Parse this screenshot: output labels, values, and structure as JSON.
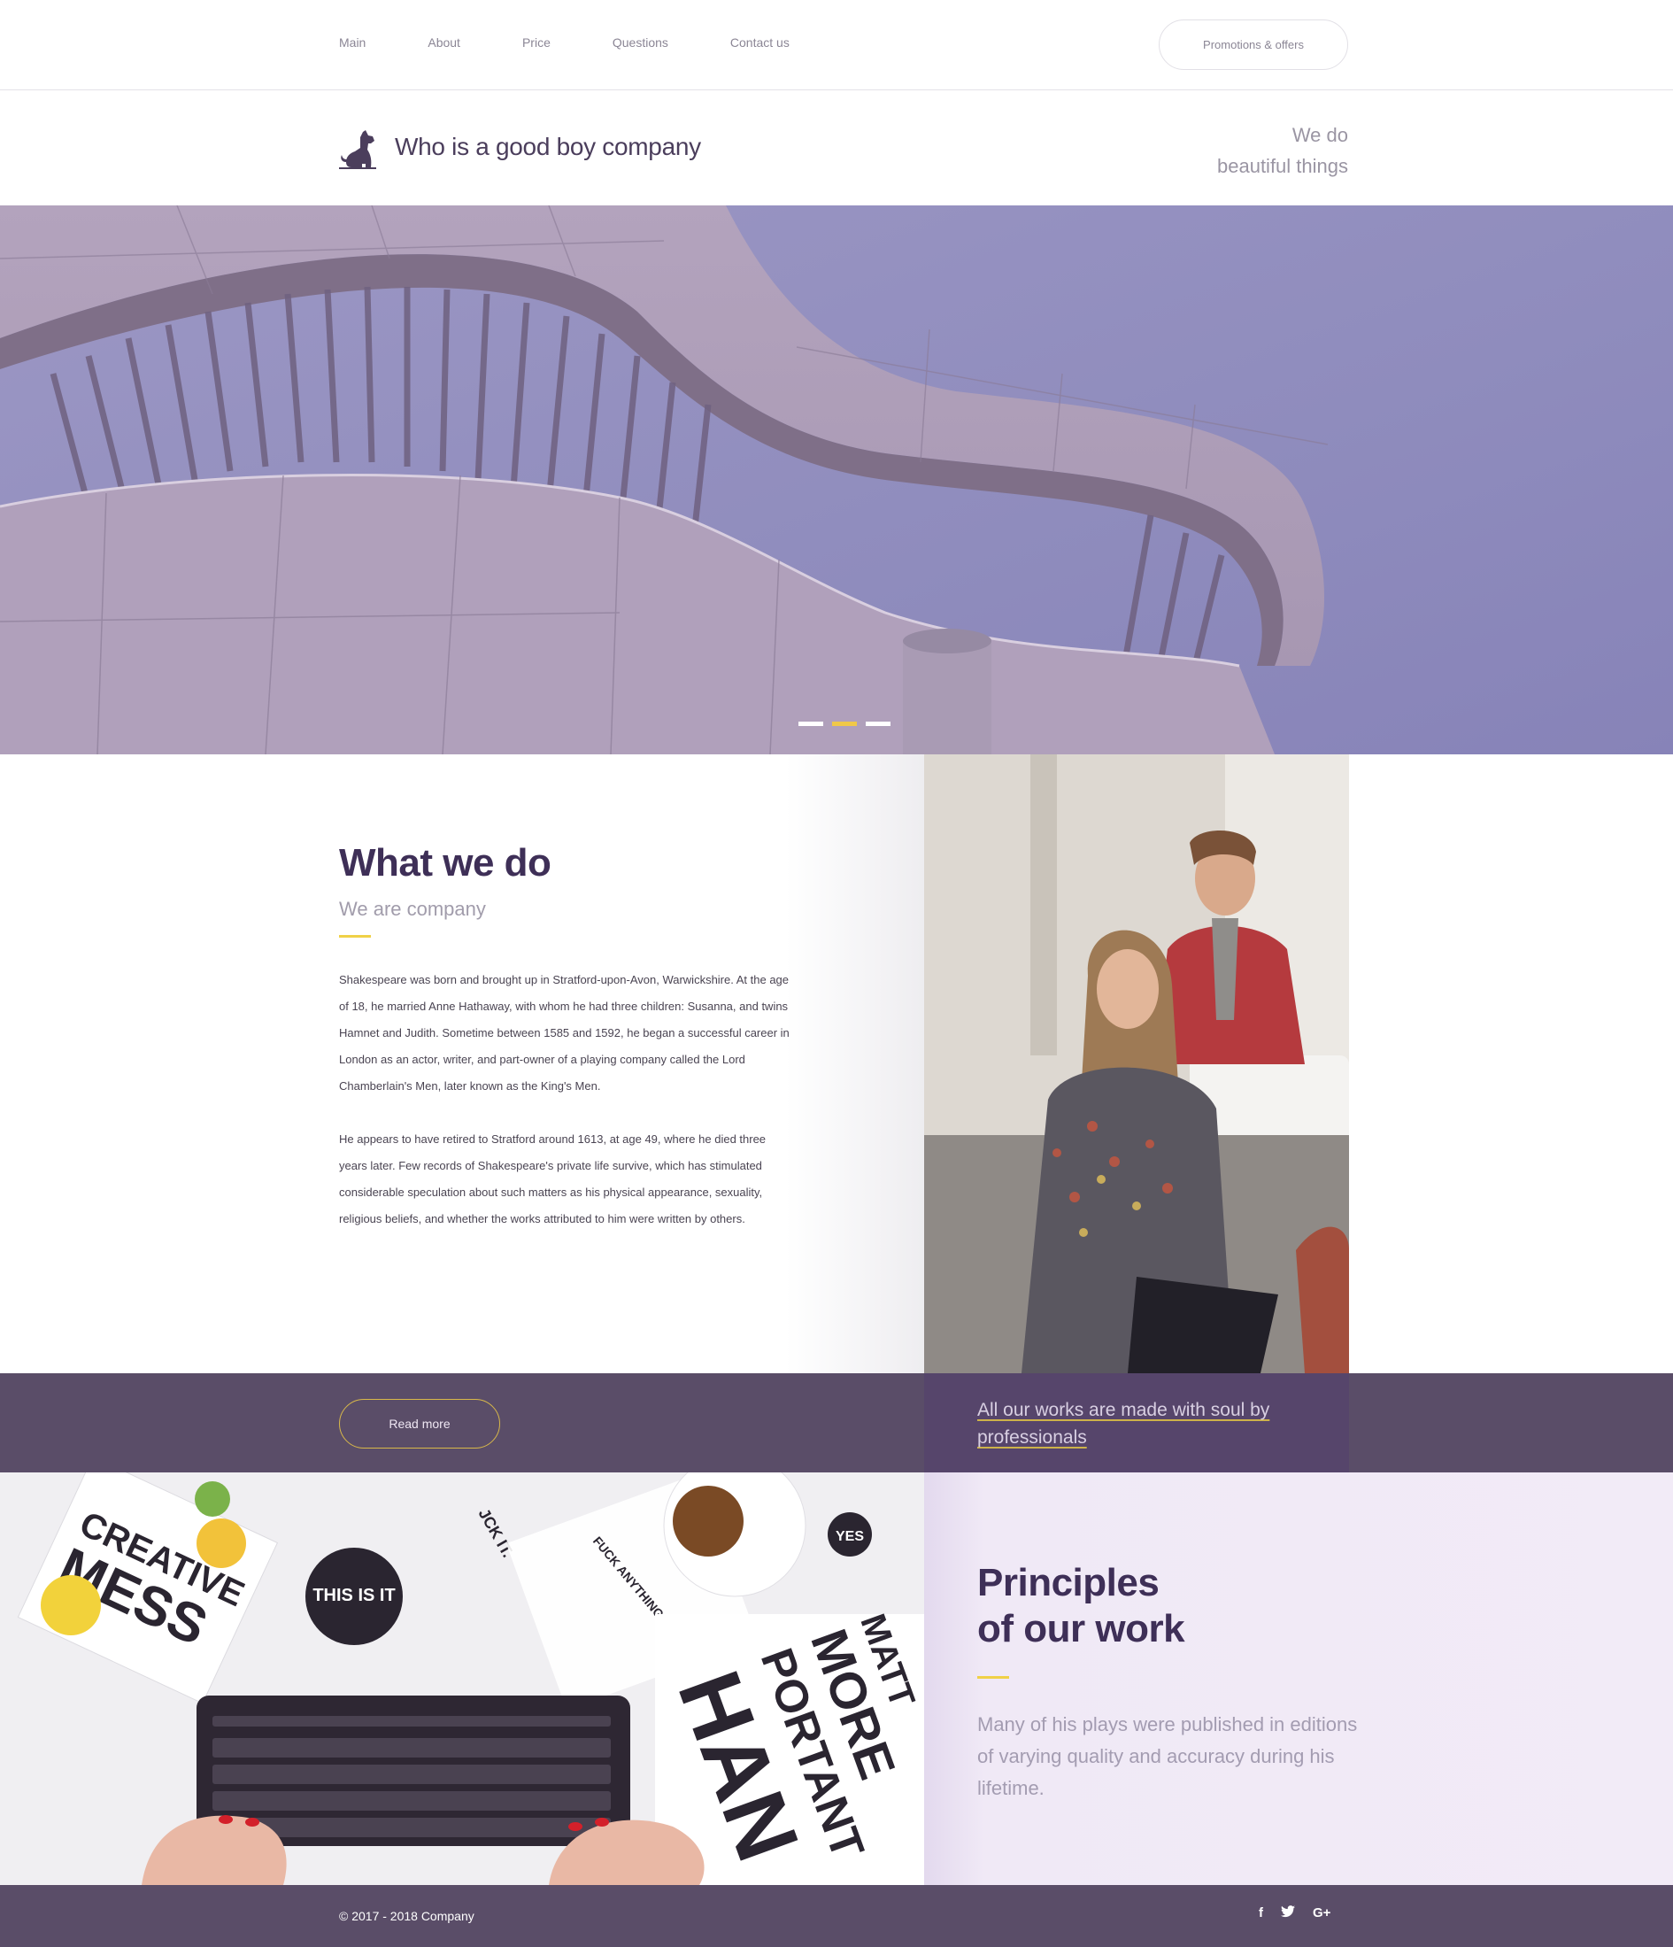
{
  "nav": {
    "items": [
      {
        "label": "Main"
      },
      {
        "label": "About"
      },
      {
        "label": "Price"
      },
      {
        "label": "Questions"
      },
      {
        "label": "Contact us"
      }
    ],
    "promo_label": "Promotions & offers"
  },
  "header": {
    "brand": "Who is a good boy company",
    "tagline_line1": "We do",
    "tagline_line2": "beautiful things",
    "logo_icon": "dog-icon"
  },
  "hero": {
    "slides_total": 3,
    "active_slide": 2
  },
  "what_we_do": {
    "title": "What we do",
    "subtitle": "We are company",
    "paragraph1": "Shakespeare was born and brought up in Stratford-upon-Avon, Warwickshire. At the age of 18, he married Anne Hathaway, with whom he had three children: Susanna, and twins Hamnet and Judith. Sometime between 1585 and 1592, he began a successful career in London as an actor, writer, and part-owner of a playing company called the Lord Chamberlain's Men, later known as the King's Men.",
    "paragraph2": "He appears to have retired to Stratford around 1613, at age 49, where he died three years later. Few records of Shakespeare's private life survive, which has stimulated considerable speculation about such matters as his physical appearance, sexuality, religious beliefs, and whether the works attributed to him were written by others."
  },
  "band": {
    "read_more": "Read more",
    "soul_link": "All our works are made with soul by professionals"
  },
  "desk_image": {
    "text_creative": "CREATIVE",
    "text_mess": "MESS",
    "text_this_is_it": "THIS IS IT",
    "text_fuck_it": "JCK IT.",
    "text_note": "FUCK ANYTHING THAT DOESN'T MAKE YOU HAPPY.",
    "text_yes": "YES",
    "text_more": "MORE",
    "text_portant": "PORTANT",
    "text_han": "HAN",
    "text_matt": "MATT"
  },
  "principles": {
    "title_line1": "Principles",
    "title_line2": "of our work",
    "body": "Many of his plays were published in editions of varying quality and accuracy during his lifetime."
  },
  "footer": {
    "copyright": "© 2017 - 2018 Company",
    "social": [
      {
        "icon": "facebook-icon",
        "glyph": "f"
      },
      {
        "icon": "twitter-icon",
        "glyph": "🐦"
      },
      {
        "icon": "google-plus-icon",
        "glyph": "G+"
      }
    ]
  },
  "colors": {
    "accent_yellow": "#f0d147",
    "brand_purple": "#3e2f57",
    "band_purple": "#5a4d68",
    "principles_bg": "#f2ebf7"
  }
}
